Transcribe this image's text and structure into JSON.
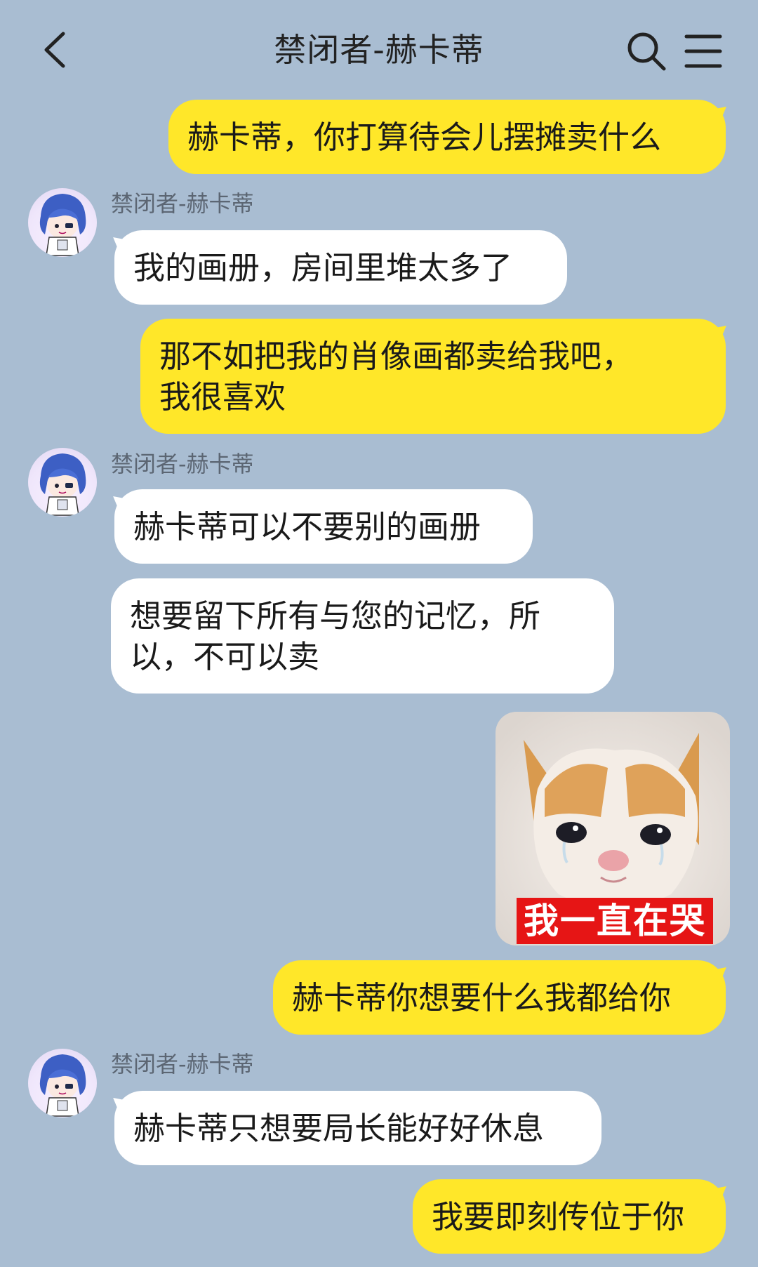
{
  "header": {
    "title": "禁闭者-赫卡蒂",
    "back_icon": "chevron-left-icon",
    "search_icon": "search-icon",
    "menu_icon": "hamburger-menu-icon"
  },
  "messages": [
    {
      "direction": "out",
      "text": "赫卡蒂，你打算待会儿摆摊卖什么"
    },
    {
      "direction": "in",
      "sender": "禁闭者-赫卡蒂",
      "text": "我的画册，房间里堆太多了"
    },
    {
      "direction": "out",
      "text": "那不如把我的肖像画都卖给我吧，\n我很喜欢"
    },
    {
      "direction": "in",
      "sender": "禁闭者-赫卡蒂",
      "text": "赫卡蒂可以不要别的画册"
    },
    {
      "direction": "in",
      "text": "想要留下所有与您的记忆，所\n以，不可以卖"
    },
    {
      "direction": "out",
      "type": "sticker",
      "caption": "我一直在哭"
    },
    {
      "direction": "out",
      "text": "赫卡蒂你想要什么我都给你"
    },
    {
      "direction": "in",
      "sender": "禁闭者-赫卡蒂",
      "text": "赫卡蒂只想要局长能好好休息"
    },
    {
      "direction": "out",
      "text": "我要即刻传位于你"
    }
  ],
  "colors": {
    "background": "#a9bdd2",
    "outgoing_bubble": "#ffe729",
    "incoming_bubble": "#ffffff",
    "sticker_caption_bg": "#e61515"
  }
}
